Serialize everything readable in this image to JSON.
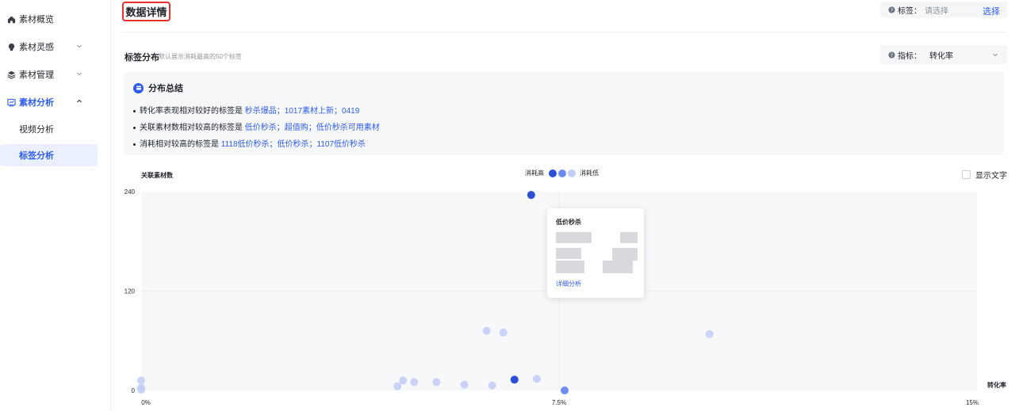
{
  "sidebar": {
    "items": [
      {
        "label": "素材概览",
        "icon": "home-icon",
        "expandable": false
      },
      {
        "label": "素材灵感",
        "icon": "bulb-icon",
        "expandable": true
      },
      {
        "label": "素材管理",
        "icon": "stack-icon",
        "expandable": true
      },
      {
        "label": "素材分析",
        "icon": "chart-icon",
        "expandable": true,
        "expanded": true,
        "children": [
          {
            "label": "视频分析",
            "active": false
          },
          {
            "label": "标签分析",
            "active": true
          }
        ]
      }
    ]
  },
  "header": {
    "title": "数据详情",
    "tag_filter_label": "标签：",
    "tag_filter_placeholder": "请选择",
    "select_label": "选择"
  },
  "section": {
    "title": "标签分布",
    "hint": "默认展示消耗最高的50个标签",
    "metric_label": "指标：",
    "metric_value": "转化率"
  },
  "summary": {
    "title": "分布总结",
    "lines": [
      {
        "prefix": "转化率表现相对较好的标签是 ",
        "links": [
          "秒杀爆品",
          "1017素材上新",
          "0419"
        ]
      },
      {
        "prefix": "关联素材数相对较高的标签是 ",
        "links": [
          "低价秒杀",
          "超值购",
          "低价秒杀可用素材"
        ]
      },
      {
        "prefix": "消耗相对较高的标签是 ",
        "links": [
          "1118低价秒杀",
          "低价秒杀",
          "1107低价秒杀"
        ]
      }
    ],
    "separator": "；"
  },
  "chart_controls": {
    "legend_high": "消耗高",
    "legend_low": "消耗低",
    "show_text_label": "显示文字"
  },
  "tooltip": {
    "title": "低价秒杀",
    "detail_link": "详细分析"
  },
  "colors": {
    "accent": "#2d5bef",
    "point_high": "#2d4fd8",
    "point_mid": "#6e8cf0",
    "point_low": "#c2cdf6",
    "highlight_border": "#e5322d"
  },
  "chart_data": {
    "type": "scatter",
    "xlabel": "转化率",
    "ylabel": "关联素材数",
    "xlim": [
      0,
      15
    ],
    "ylim": [
      0,
      240
    ],
    "x_ticks": [
      "0%",
      "7.5%",
      "15%"
    ],
    "y_ticks": [
      "0",
      "120",
      "240"
    ],
    "legend": [
      "消耗高",
      "消耗低"
    ],
    "grid": true,
    "points": [
      {
        "x": 7.0,
        "y": 236,
        "level": "high"
      },
      {
        "x": 0.0,
        "y": 12,
        "level": "low"
      },
      {
        "x": 0.0,
        "y": 3,
        "level": "low"
      },
      {
        "x": 0.0,
        "y": 1,
        "level": "low"
      },
      {
        "x": 4.7,
        "y": 12,
        "level": "low"
      },
      {
        "x": 4.9,
        "y": 10,
        "level": "low"
      },
      {
        "x": 5.3,
        "y": 10,
        "level": "low"
      },
      {
        "x": 4.6,
        "y": 5,
        "level": "low"
      },
      {
        "x": 5.8,
        "y": 7,
        "level": "low"
      },
      {
        "x": 6.3,
        "y": 6,
        "level": "low"
      },
      {
        "x": 6.7,
        "y": 13,
        "level": "high"
      },
      {
        "x": 7.1,
        "y": 14,
        "level": "low"
      },
      {
        "x": 7.6,
        "y": 0,
        "level": "mid"
      },
      {
        "x": 6.2,
        "y": 72,
        "level": "low"
      },
      {
        "x": 6.5,
        "y": 70,
        "level": "low"
      },
      {
        "x": 10.2,
        "y": 68,
        "level": "low"
      }
    ]
  }
}
